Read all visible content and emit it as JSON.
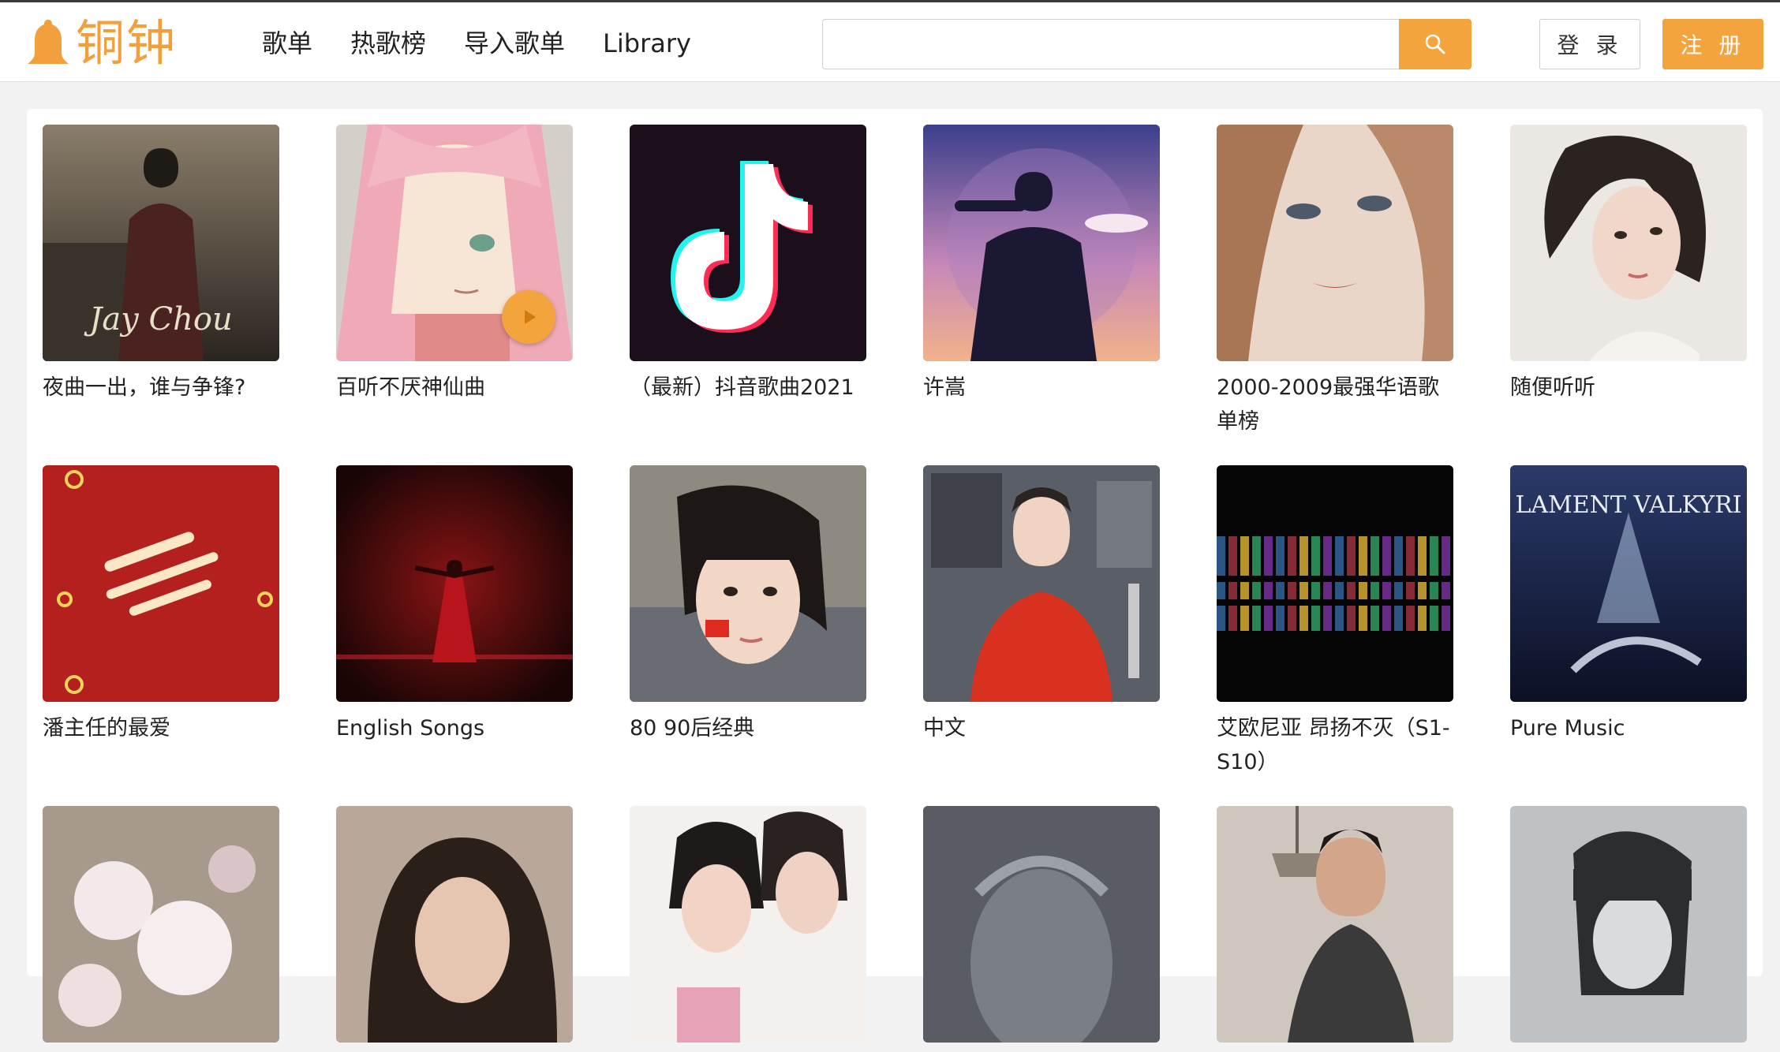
{
  "header": {
    "logo_text": "铜钟",
    "nav": [
      "歌单",
      "热歌榜",
      "导入歌单",
      "Library"
    ],
    "search": {
      "placeholder": "",
      "value": ""
    },
    "login_label": "登 录",
    "register_label": "注 册",
    "accent_color": "#f4a43c"
  },
  "playlists": [
    {
      "title": "夜曲一出，谁与争锋?",
      "cover_theme": "dark-sepia-portrait",
      "cover_text": "Jay Chou"
    },
    {
      "title": "百听不厌神仙曲",
      "cover_theme": "anime-pink-hair",
      "cover_text": ""
    },
    {
      "title": "（最新）抖音歌曲2021",
      "cover_theme": "tiktok-logo",
      "cover_text": ""
    },
    {
      "title": "许嵩",
      "cover_theme": "purple-sunset-silhouette",
      "cover_text": ""
    },
    {
      "title": "2000-2009最强华语歌单榜",
      "cover_theme": "face-closeup",
      "cover_text": ""
    },
    {
      "title": "随便听听",
      "cover_theme": "portrait-light",
      "cover_text": ""
    },
    {
      "title": "潘主任的最爱",
      "cover_theme": "red-calligraphy",
      "cover_text": ""
    },
    {
      "title": "English Songs",
      "cover_theme": "red-sparkle-stage",
      "cover_text": ""
    },
    {
      "title": "80 90后经典",
      "cover_theme": "girl-with-flag",
      "cover_text": ""
    },
    {
      "title": "中文",
      "cover_theme": "singer-red-hoodie",
      "cover_text": ""
    },
    {
      "title": "艾欧尼亚 昂扬不灭（S1-S10）",
      "cover_theme": "stained-glass-dark",
      "cover_text": ""
    },
    {
      "title": "Pure Music",
      "cover_theme": "fantasy-blue",
      "cover_text": "LAMENT VALKYRI"
    },
    {
      "title": "",
      "cover_theme": "blossom",
      "cover_text": ""
    },
    {
      "title": "",
      "cover_theme": "portrait-dark-hair",
      "cover_text": ""
    },
    {
      "title": "",
      "cover_theme": "two-girls",
      "cover_text": ""
    },
    {
      "title": "",
      "cover_theme": "grey-statue",
      "cover_text": ""
    },
    {
      "title": "",
      "cover_theme": "woman-chandelier",
      "cover_text": ""
    },
    {
      "title": "",
      "cover_theme": "anime-dark-boy",
      "cover_text": ""
    }
  ],
  "hovered_index": 1
}
